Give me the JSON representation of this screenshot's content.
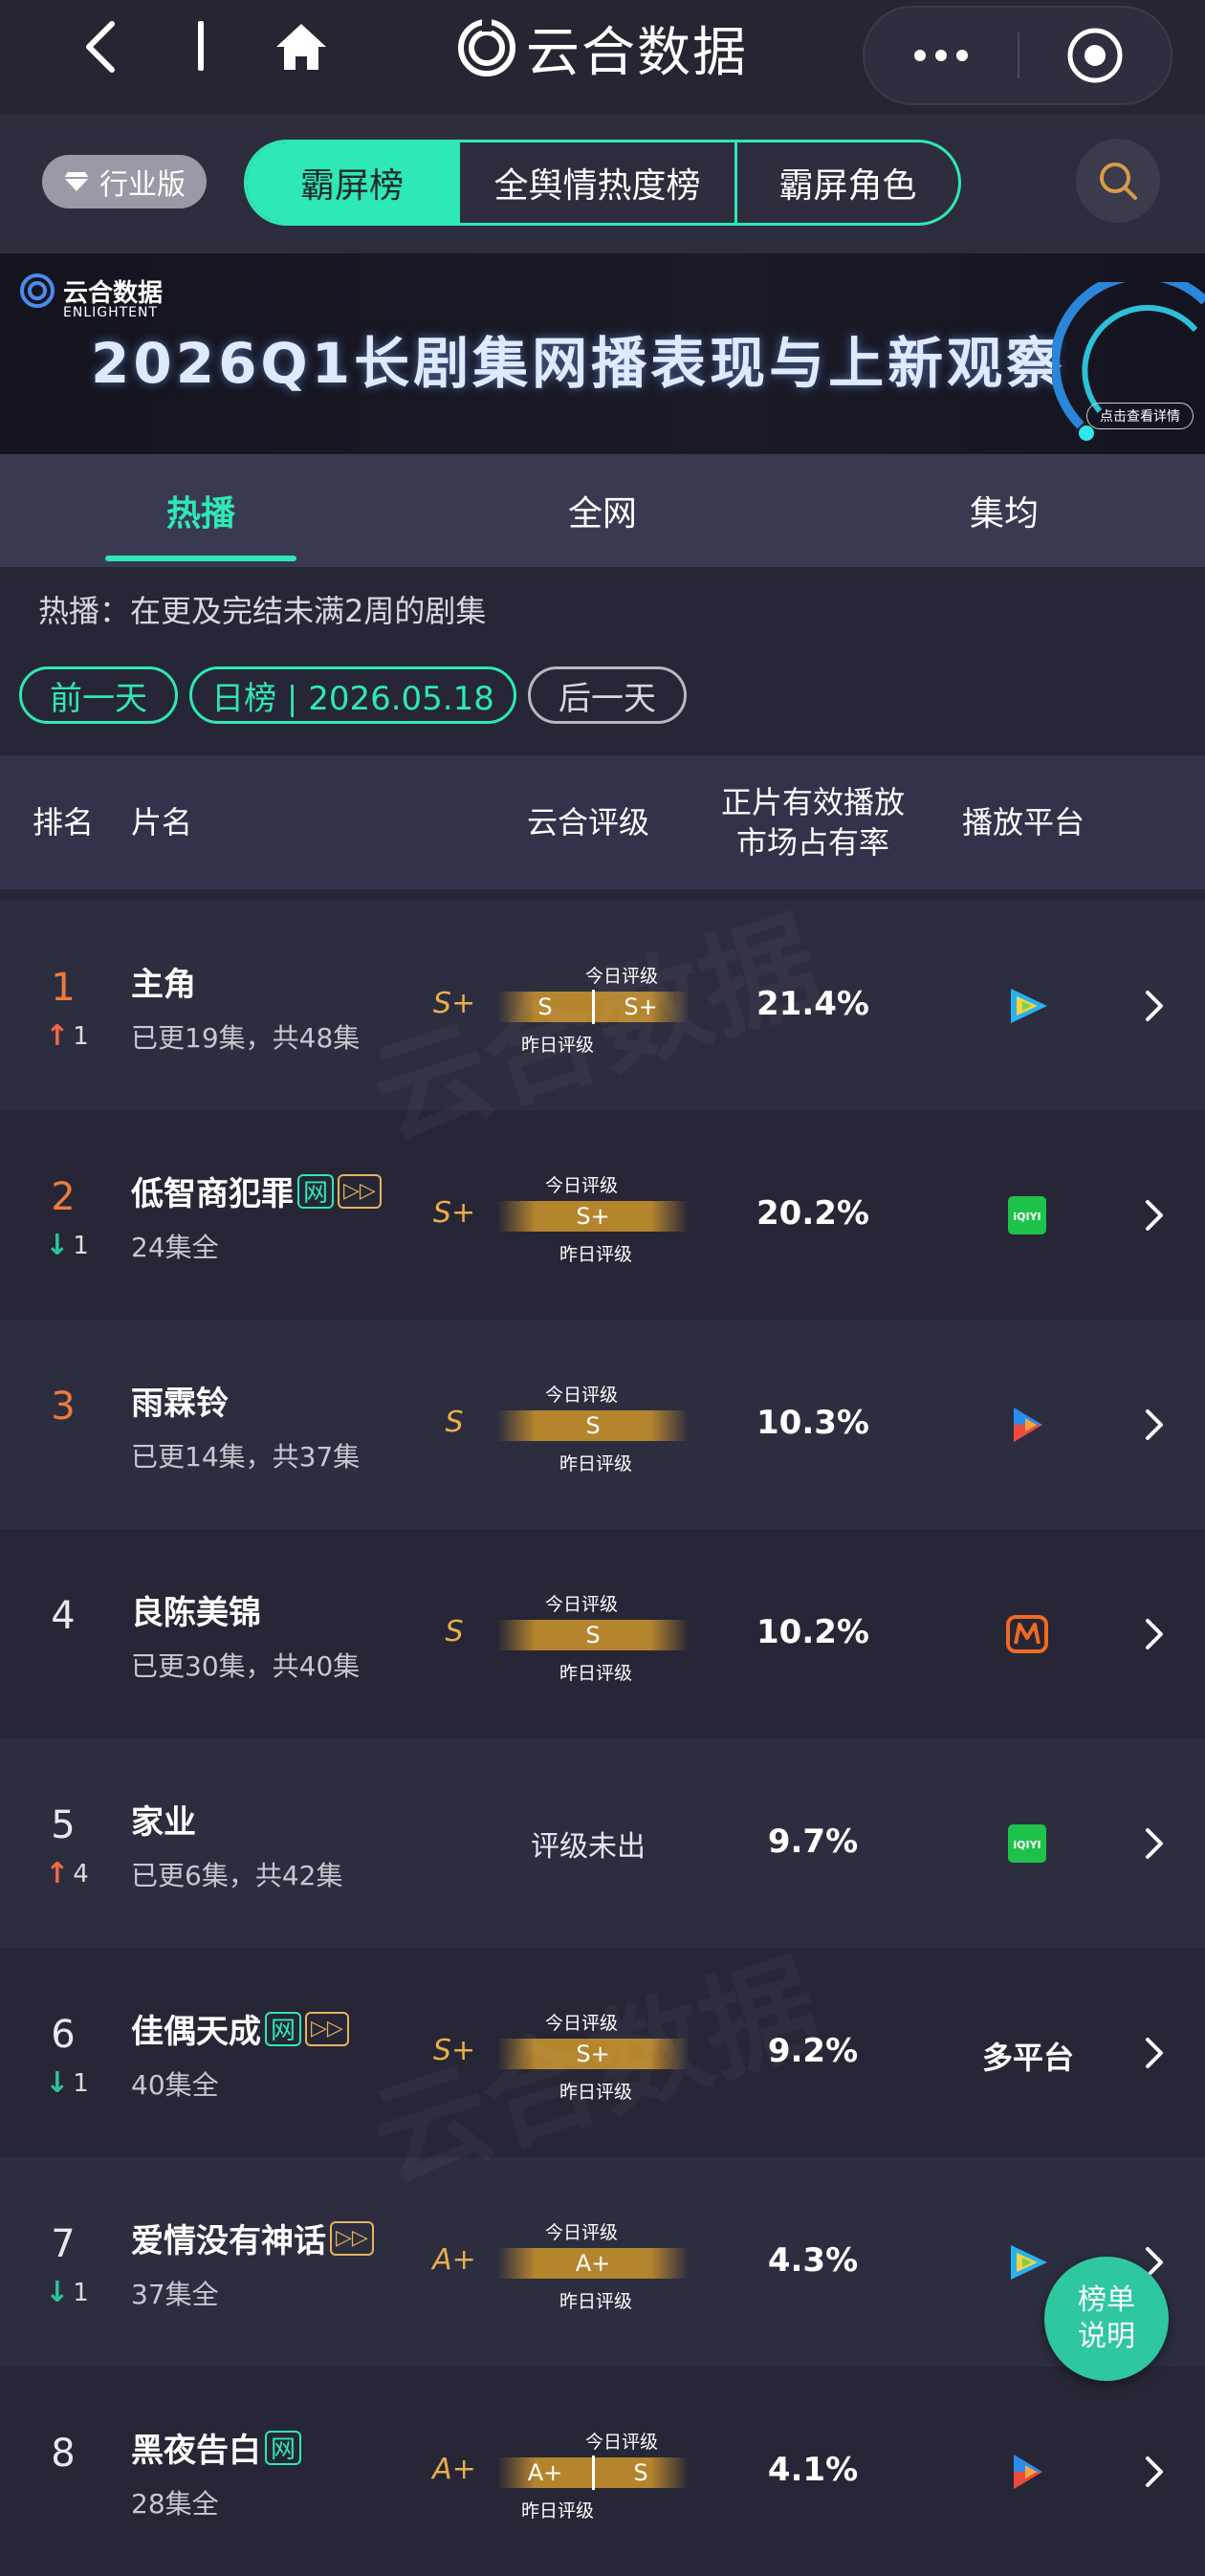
{
  "app": {
    "brand_name": "云合数据"
  },
  "tabs_top": {
    "industry_label": "行业版",
    "items": [
      "霸屏榜",
      "全舆情热度榜",
      "霸屏角色"
    ],
    "active_index": 0
  },
  "banner": {
    "logo_cn": "云合数据",
    "logo_en": "ENLIGHTENT",
    "title": "2026Q1长剧集网播表现与上新观察",
    "cta": "点击查看详情"
  },
  "subtabs": {
    "items": [
      "热播",
      "全网",
      "集均"
    ],
    "active_index": 0
  },
  "note": "热播：在更及完结未满2周的剧集",
  "date_nav": {
    "prev": "前一天",
    "current": "日榜 | 2026.05.18",
    "next": "后一天"
  },
  "table": {
    "headers": {
      "rank": "排名",
      "title": "片名",
      "grade": "云合评级",
      "share_l1": "正片有效播放",
      "share_l2": "市场占有率",
      "platform": "播放平台"
    },
    "grade_today_label": "今日评级",
    "grade_yesterday_label": "昨日评级",
    "rows": [
      {
        "rank": "1",
        "change": "1",
        "change_dir": "up",
        "title": "主角",
        "tags": [],
        "episodes": "已更19集，共48集",
        "grade": "S+",
        "yesterday": "S",
        "today": "S+",
        "share": "21.4%",
        "platform": "tencent"
      },
      {
        "rank": "2",
        "change": "1",
        "change_dir": "down",
        "title": "低智商犯罪",
        "tags": [
          "网",
          "vip"
        ],
        "episodes": "24集全",
        "grade": "S+",
        "yesterday": "S+",
        "today": "S+",
        "share": "20.2%",
        "platform": "iqiyi"
      },
      {
        "rank": "3",
        "change": "",
        "change_dir": "",
        "title": "雨霖铃",
        "tags": [],
        "episodes": "已更14集，共37集",
        "grade": "S",
        "yesterday": "S",
        "today": "S",
        "share": "10.3%",
        "platform": "youku"
      },
      {
        "rank": "4",
        "change": "",
        "change_dir": "",
        "title": "良陈美锦",
        "tags": [],
        "episodes": "已更30集，共40集",
        "grade": "S",
        "yesterday": "S",
        "today": "S",
        "share": "10.2%",
        "platform": "mango"
      },
      {
        "rank": "5",
        "change": "4",
        "change_dir": "up",
        "title": "家业",
        "tags": [],
        "episodes": "已更6集，共42集",
        "grade": "",
        "no_grade": "评级未出",
        "share": "9.7%",
        "platform": "iqiyi"
      },
      {
        "rank": "6",
        "change": "1",
        "change_dir": "down",
        "title": "佳偶天成",
        "tags": [
          "网",
          "vip"
        ],
        "episodes": "40集全",
        "grade": "S+",
        "yesterday": "S+",
        "today": "S+",
        "share": "9.2%",
        "platform_text": "多平台"
      },
      {
        "rank": "7",
        "change": "1",
        "change_dir": "down",
        "title": "爱情没有神话",
        "tags": [
          "vip"
        ],
        "episodes": "37集全",
        "grade": "A+",
        "yesterday": "A+",
        "today": "A+",
        "share": "4.3%",
        "platform": "tencent"
      },
      {
        "rank": "8",
        "change": "",
        "change_dir": "",
        "title": "黑夜告白",
        "tags": [
          "网"
        ],
        "episodes": "28集全",
        "grade": "A+",
        "yesterday": "A+",
        "today": "S",
        "share": "4.1%",
        "platform": "youku"
      }
    ]
  },
  "fab": {
    "line1": "榜单",
    "line2": "说明"
  },
  "colors": {
    "accent": "#2ee8b6",
    "gold": "#e8b04a",
    "up": "#ee6a45",
    "down": "#2ec39a",
    "rank_top": "#ef7a3c"
  }
}
